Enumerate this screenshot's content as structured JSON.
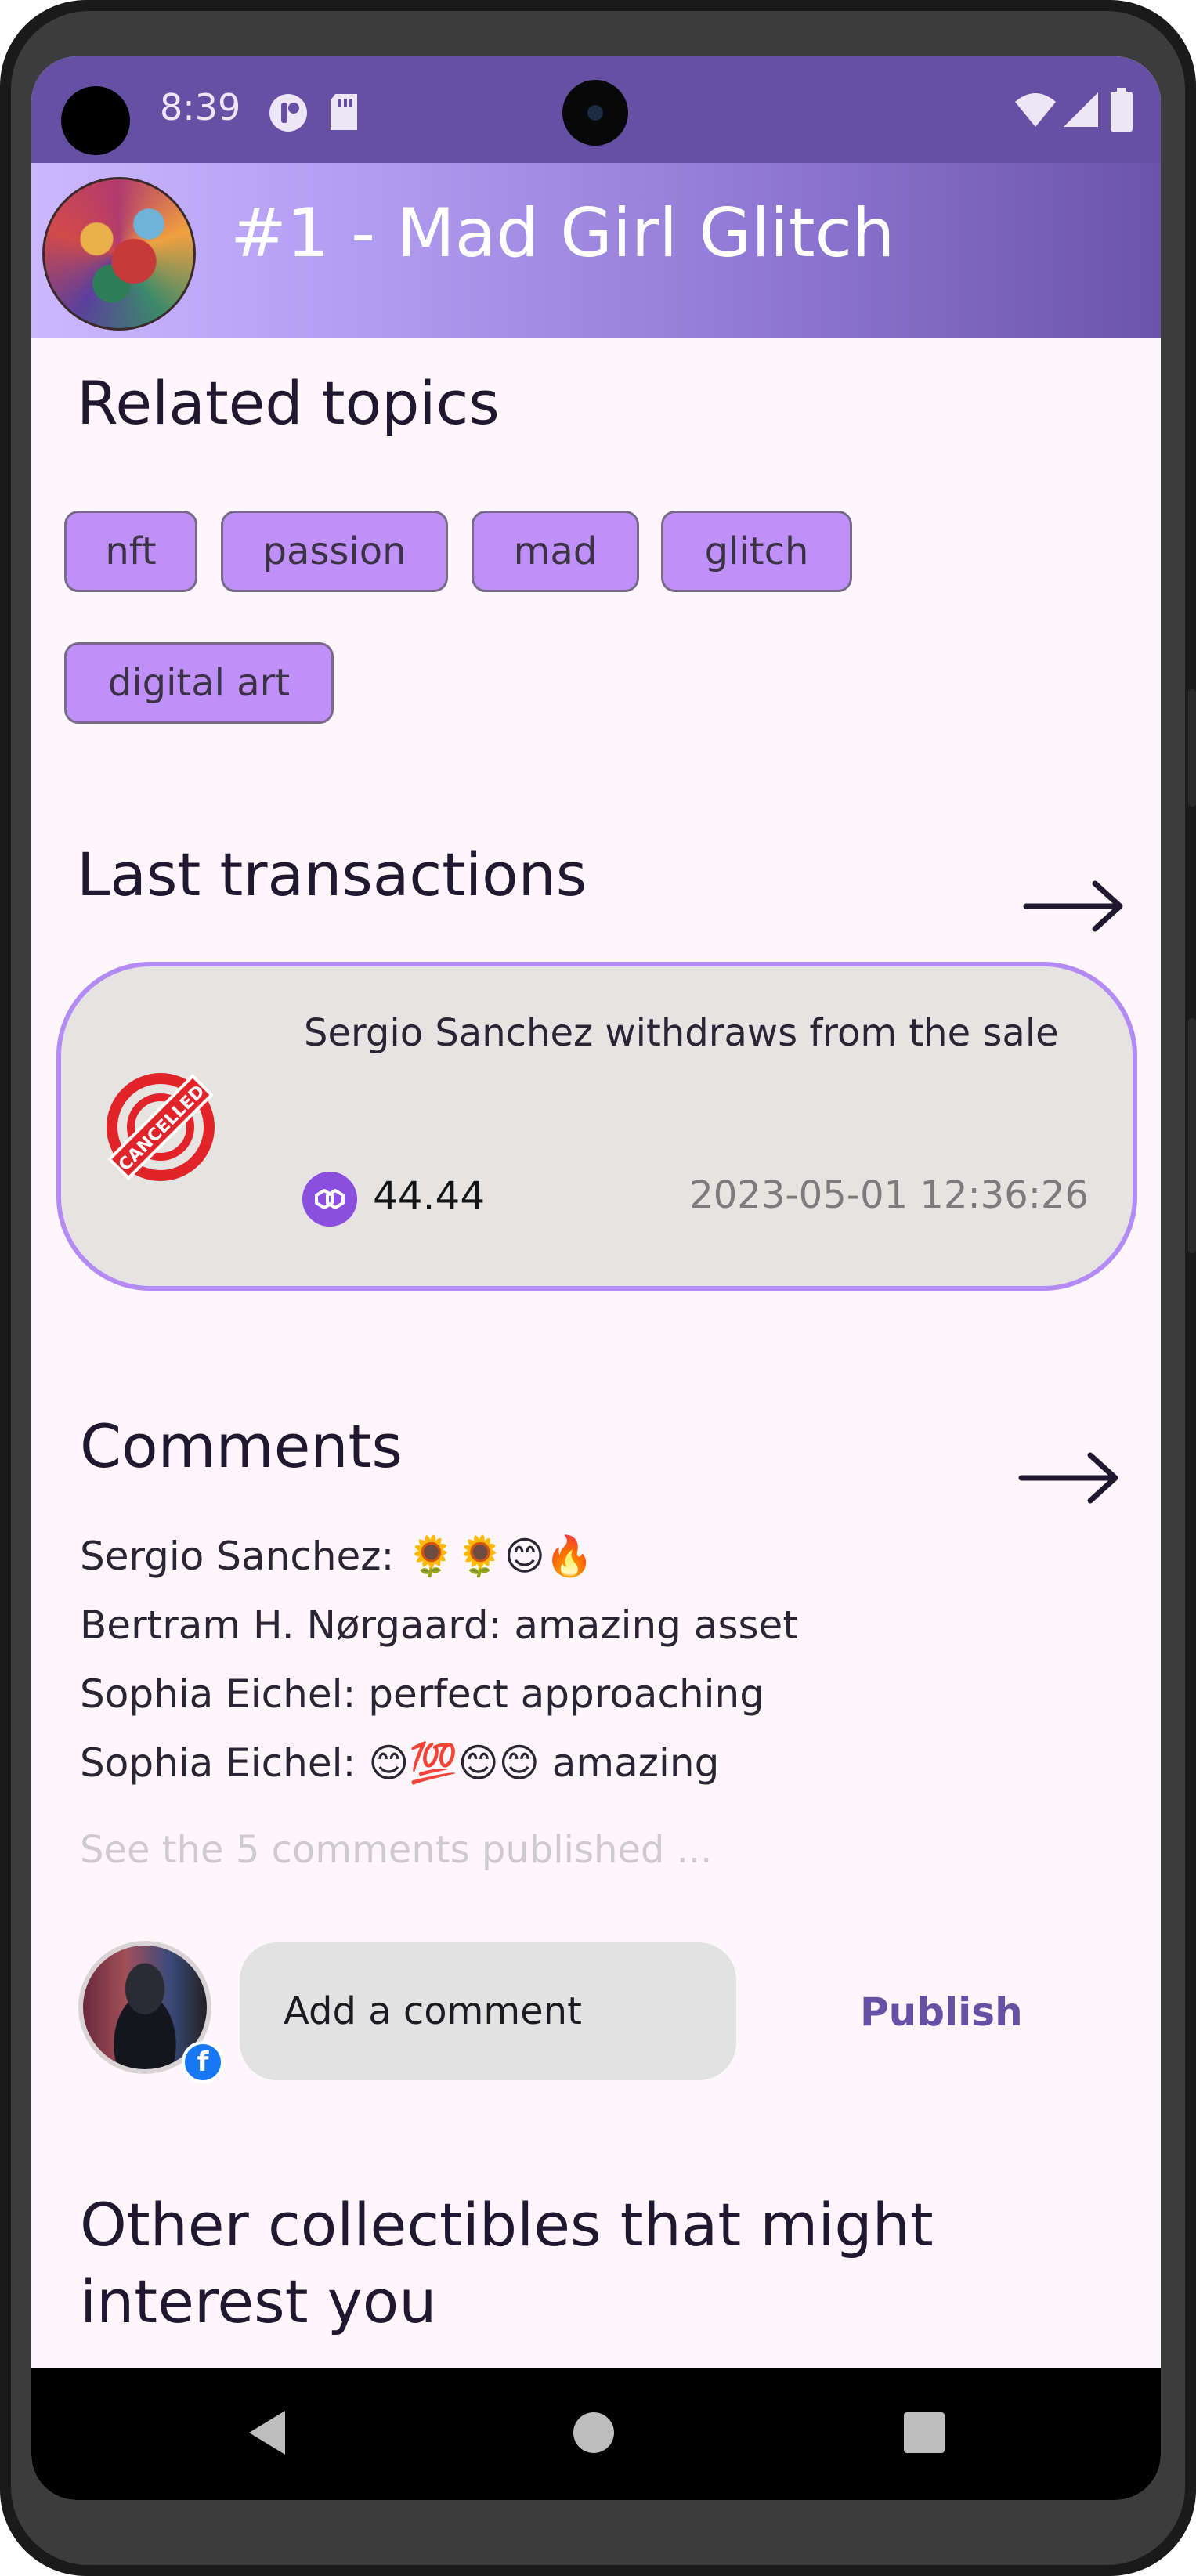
{
  "status_bar": {
    "time": "8:39"
  },
  "header": {
    "title": "#1 - Mad Girl Glitch"
  },
  "related_topics": {
    "title": "Related topics",
    "chips": [
      "nft",
      "passion",
      "mad",
      "glitch",
      "digital art"
    ]
  },
  "transactions": {
    "title": "Last transactions",
    "items": [
      {
        "status_icon_text": "CANCELLED",
        "text": "Sergio Sanchez withdraws from the sale",
        "amount": "44.44",
        "date": "2023-05-01 12:36:26"
      }
    ]
  },
  "comments": {
    "title": "Comments",
    "items": [
      "Sergio Sanchez: 🌻🌻😊🔥",
      "Bertram H. Nørgaard: amazing asset",
      "Sophia Eichel: perfect approaching",
      "Sophia Eichel: 😊💯😊😊 amazing"
    ],
    "see_more": "See the 5 comments published ...",
    "input_placeholder": "Add a comment",
    "publish_label": "Publish"
  },
  "other": {
    "title": "Other collectibles that might interest you"
  },
  "colors": {
    "primary": "#6650a4",
    "chip": "#bf90f7",
    "card_border": "#b48af5",
    "cancel_red": "#e0242a",
    "polygon": "#8b4fe0"
  }
}
